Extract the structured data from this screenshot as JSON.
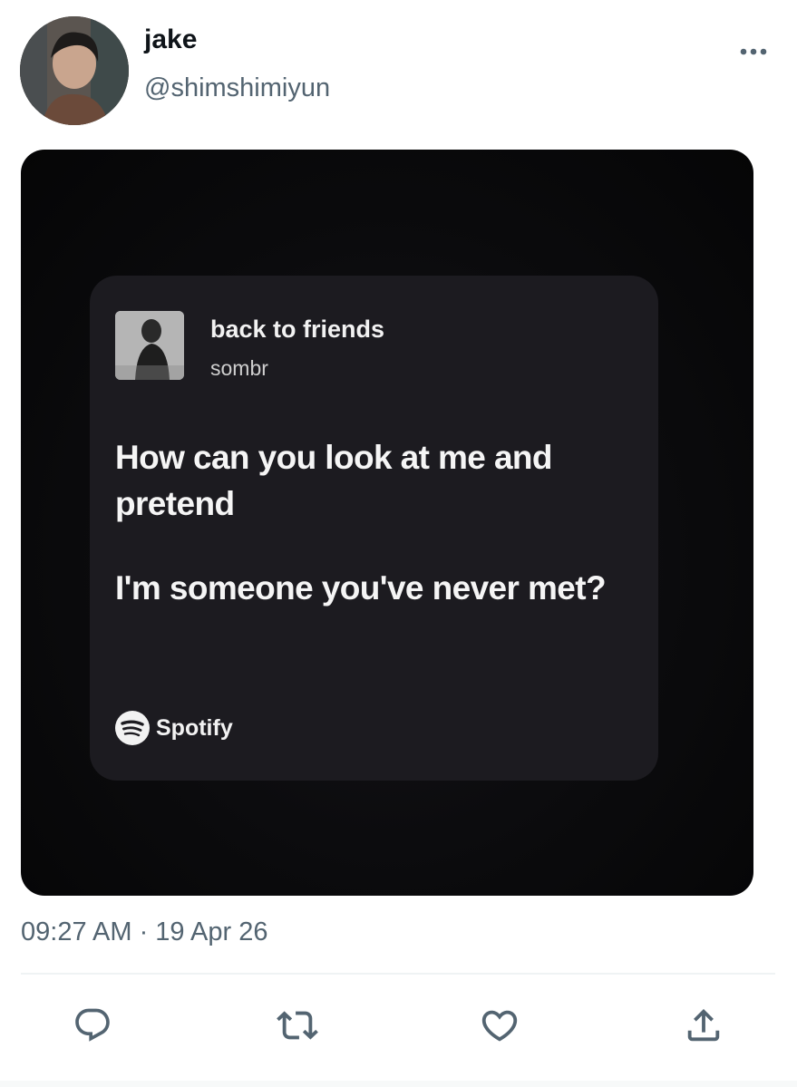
{
  "tweet": {
    "display_name": "jake",
    "handle": "@shimshimiyun",
    "timestamp": "09:27 AM · 19 Apr 26"
  },
  "lyric_card": {
    "song_title": "back to friends",
    "artist": "sombr",
    "lyrics": [
      "How can you look at me and pretend",
      "I'm someone you've never met?"
    ],
    "brand": "Spotify"
  },
  "icons": {
    "more": "more-horizontal-icon",
    "reply": "reply-icon",
    "retweet": "retweet-icon",
    "like": "heart-icon",
    "share": "share-icon",
    "brand": "spotify-icon"
  },
  "colors": {
    "name_text": "#0f1419",
    "secondary_text": "#536471",
    "card_background": "#1c1b20",
    "media_background": "#0b0b0d"
  }
}
